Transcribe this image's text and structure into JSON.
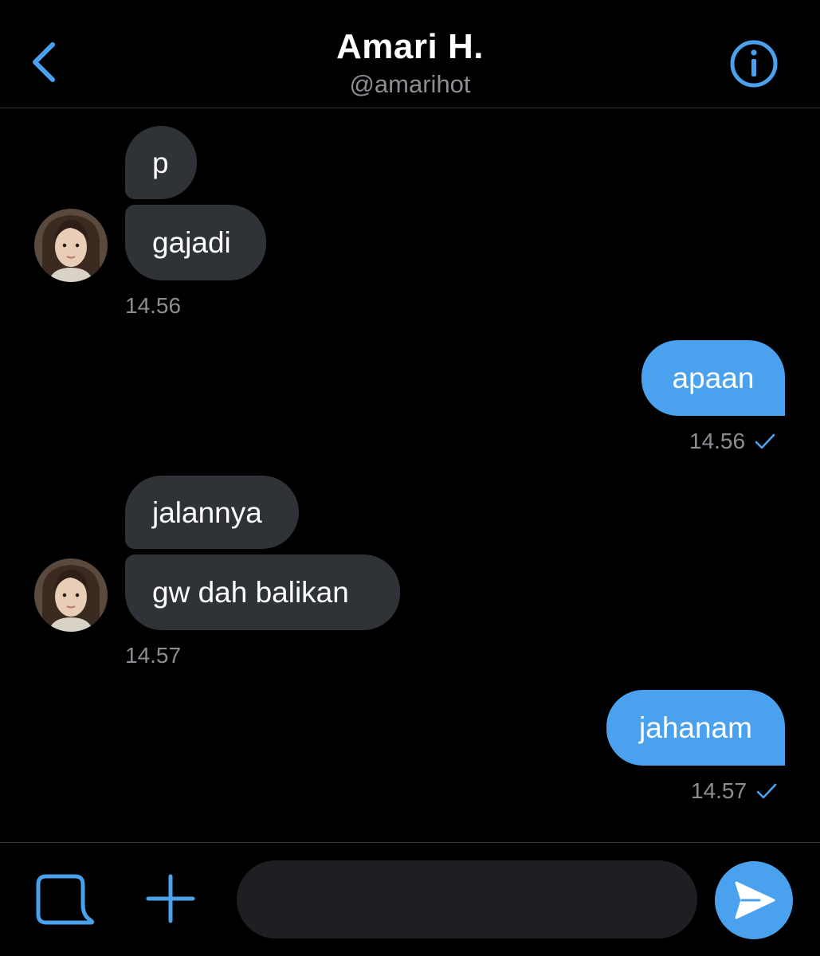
{
  "header": {
    "name": "Amari H.",
    "handle": "@amarihot",
    "back_icon": "chevron-left-icon",
    "info_icon": "info-icon"
  },
  "colors": {
    "accent": "#4aa1ed",
    "background": "#000000",
    "incoming_bubble": "#2f3236",
    "secondary_text": "#8b8f94"
  },
  "messages": [
    {
      "id": "m1",
      "direction": "incoming",
      "text": "p"
    },
    {
      "id": "m2",
      "direction": "incoming",
      "text": "gajadi",
      "time": "14.56"
    },
    {
      "id": "m3",
      "direction": "outgoing",
      "text": "apaan",
      "time": "14.56",
      "status_icon": "checkmark-icon"
    },
    {
      "id": "m4",
      "direction": "incoming",
      "text": "jalannya"
    },
    {
      "id": "m5",
      "direction": "incoming",
      "text": "gw dah balikan",
      "time": "14.57"
    },
    {
      "id": "m6",
      "direction": "outgoing",
      "text": "jahanam",
      "time": "14.57",
      "status_icon": "checkmark-icon"
    }
  ],
  "composer": {
    "value": "",
    "gif_icon": "gif-icon",
    "plus_icon": "plus-icon",
    "send_icon": "send-icon"
  }
}
